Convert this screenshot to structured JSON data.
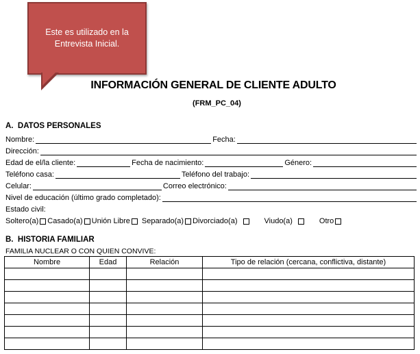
{
  "callout": {
    "text": "Este es utilizado en la Entrevista Inicial."
  },
  "header": {
    "title": "INFORMACIÓN GENERAL DE CLIENTE ADULTO",
    "code": "(FRM_PC_04)"
  },
  "section_a": {
    "heading": "A.  DATOS PERSONALES",
    "nombre": "Nombre:",
    "fecha": "Fecha:",
    "direccion": "Dirección:",
    "edad": "Edad de el/la cliente:",
    "fecha_nacimiento": "Fecha de nacimiento:",
    "genero": "Género:",
    "telefono_casa": "Teléfono casa:",
    "telefono_trabajo": "Teléfono del trabajo:",
    "celular": "Celular:",
    "correo": "Correo electrónico:",
    "educacion": "Nivel de educación (último grado completado):",
    "estado_civil": "Estado civil:",
    "civil_options": {
      "soltero": "Soltero(a)",
      "casado": "Casado(a)",
      "union": "Unión Libre",
      "separado": "Separado(a)",
      "divorciado": "Divorciado(a)",
      "viudo": "Viudo(a)",
      "otro": "Otro"
    }
  },
  "section_b": {
    "heading": "B.  HISTORIA FAMILIAR",
    "subheading": "FAMILIA NUCLEAR O CON QUIEN CONVIVE:",
    "columns": {
      "nombre": "Nombre",
      "edad": "Edad",
      "relacion": "Relación",
      "tipo": "Tipo de relación (cercana, conflictiva, distante)"
    }
  }
}
